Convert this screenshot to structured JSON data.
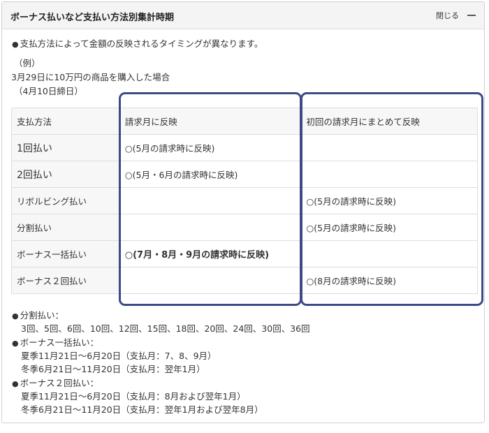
{
  "header": {
    "title": "ボーナス払いなど支払い方法別集計時期",
    "close_label": "閉じる"
  },
  "intro": "支払方法によって金額の反映されるタイミングが異なります。",
  "example": {
    "label": "（例）",
    "line1": "3月29日に10万円の商品を購入した場合",
    "line2": "（4月10日締日）"
  },
  "table": {
    "headers": [
      "支払方法",
      "請求月に反映",
      "初回の請求月にまとめて反映"
    ],
    "rows": [
      {
        "method": "1回払い",
        "reflect": "○(5月の請求時に反映)",
        "initial": ""
      },
      {
        "method": "2回払い",
        "reflect": "○(5月・6月の請求時に反映)",
        "initial": ""
      },
      {
        "method": "リボルビング払い",
        "reflect": "",
        "initial": "○(5月の請求時に反映)"
      },
      {
        "method": "分割払い",
        "reflect": "",
        "initial": "○(5月の請求時に反映)"
      },
      {
        "method": "ボーナス一括払い",
        "reflect": "○(7月・8月・9月の請求時に反映)",
        "initial": ""
      },
      {
        "method": "ボーナス２回払い",
        "reflect": "",
        "initial": "○(8月の請求時に反映)"
      }
    ]
  },
  "notes": {
    "bunkatsu": {
      "title": "分割払い：",
      "line": "3回、5回、6回、10回、12回、15回、18回、20回、24回、30回、36回"
    },
    "bonus_ikkatsu": {
      "title": "ボーナス一括払い：",
      "summer": "夏季11月21日〜6月20日（支払月：7、8、9月）",
      "winter": "冬季6月21日〜11月20日（支払月：翌年1月）"
    },
    "bonus_2kai": {
      "title": "ボーナス２回払い：",
      "summer": "夏季11月21日〜6月20日（支払月：8月および翌年1月）",
      "winter": "冬季6月21日〜11月20日（支払月：翌年1月および翌年8月）"
    }
  },
  "colors": {
    "highlight": "#3c4a86",
    "header_bg": "#f4f4f4",
    "border": "#dddddd"
  }
}
